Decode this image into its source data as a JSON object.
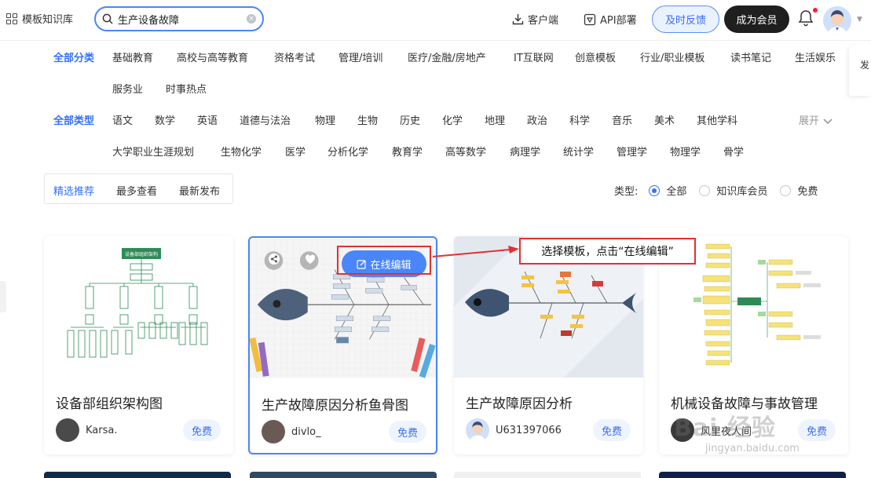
{
  "header": {
    "brand": "模板知识库",
    "search_value": "生产设备故障",
    "client_label": "客户端",
    "api_label": "API部署",
    "feedback_label": "及时反馈",
    "member_label": "成为会员"
  },
  "side_tab": {
    "label": "发"
  },
  "category": {
    "label": "全部分类",
    "items": [
      "基础教育",
      "高校与高等教育",
      "资格考试",
      "管理/培训",
      "医疗/金融/房地产",
      "IT互联网",
      "创意模板",
      "行业/职业模板",
      "读书笔记",
      "生活娱乐",
      "服务业",
      "时事热点"
    ]
  },
  "types": {
    "label": "全部类型",
    "items": [
      "语文",
      "数学",
      "英语",
      "道德与法治",
      "物理",
      "生物",
      "历史",
      "化学",
      "地理",
      "政治",
      "科学",
      "音乐",
      "美术",
      "其他学科",
      "大学职业生涯规划",
      "生物化学",
      "医学",
      "分析化学",
      "教育学",
      "高等数学",
      "病理学",
      "统计学",
      "管理学",
      "物理学",
      "骨学"
    ],
    "expand": "展开"
  },
  "sort_tabs": [
    "精选推荐",
    "最多查看",
    "最新发布"
  ],
  "type_filter": {
    "label": "类型:",
    "options": [
      "全部",
      "知识库会员",
      "免费"
    ],
    "selected": 0
  },
  "cards": [
    {
      "title": "设备部组织架构图",
      "author": "Karsa.",
      "badge": "免费",
      "thumb_title": "设备部组织架构"
    },
    {
      "title": "生产故障原因分析鱼骨图",
      "author": "divlo_",
      "badge": "免费",
      "edit_label": "在线编辑"
    },
    {
      "title": "生产故障原因分析",
      "author": "U631397066",
      "badge": "免费"
    },
    {
      "title": "机械设备故障与事故管理",
      "author": "风里夜人间",
      "badge": "免费"
    }
  ],
  "callout": {
    "text": "选择模板，点击“在线编辑”"
  },
  "watermark": {
    "main": "Bai 经验",
    "sub": "jingyan.baidu.com"
  },
  "colors": {
    "accent": "#3370ff",
    "annotation": "#e23131"
  }
}
